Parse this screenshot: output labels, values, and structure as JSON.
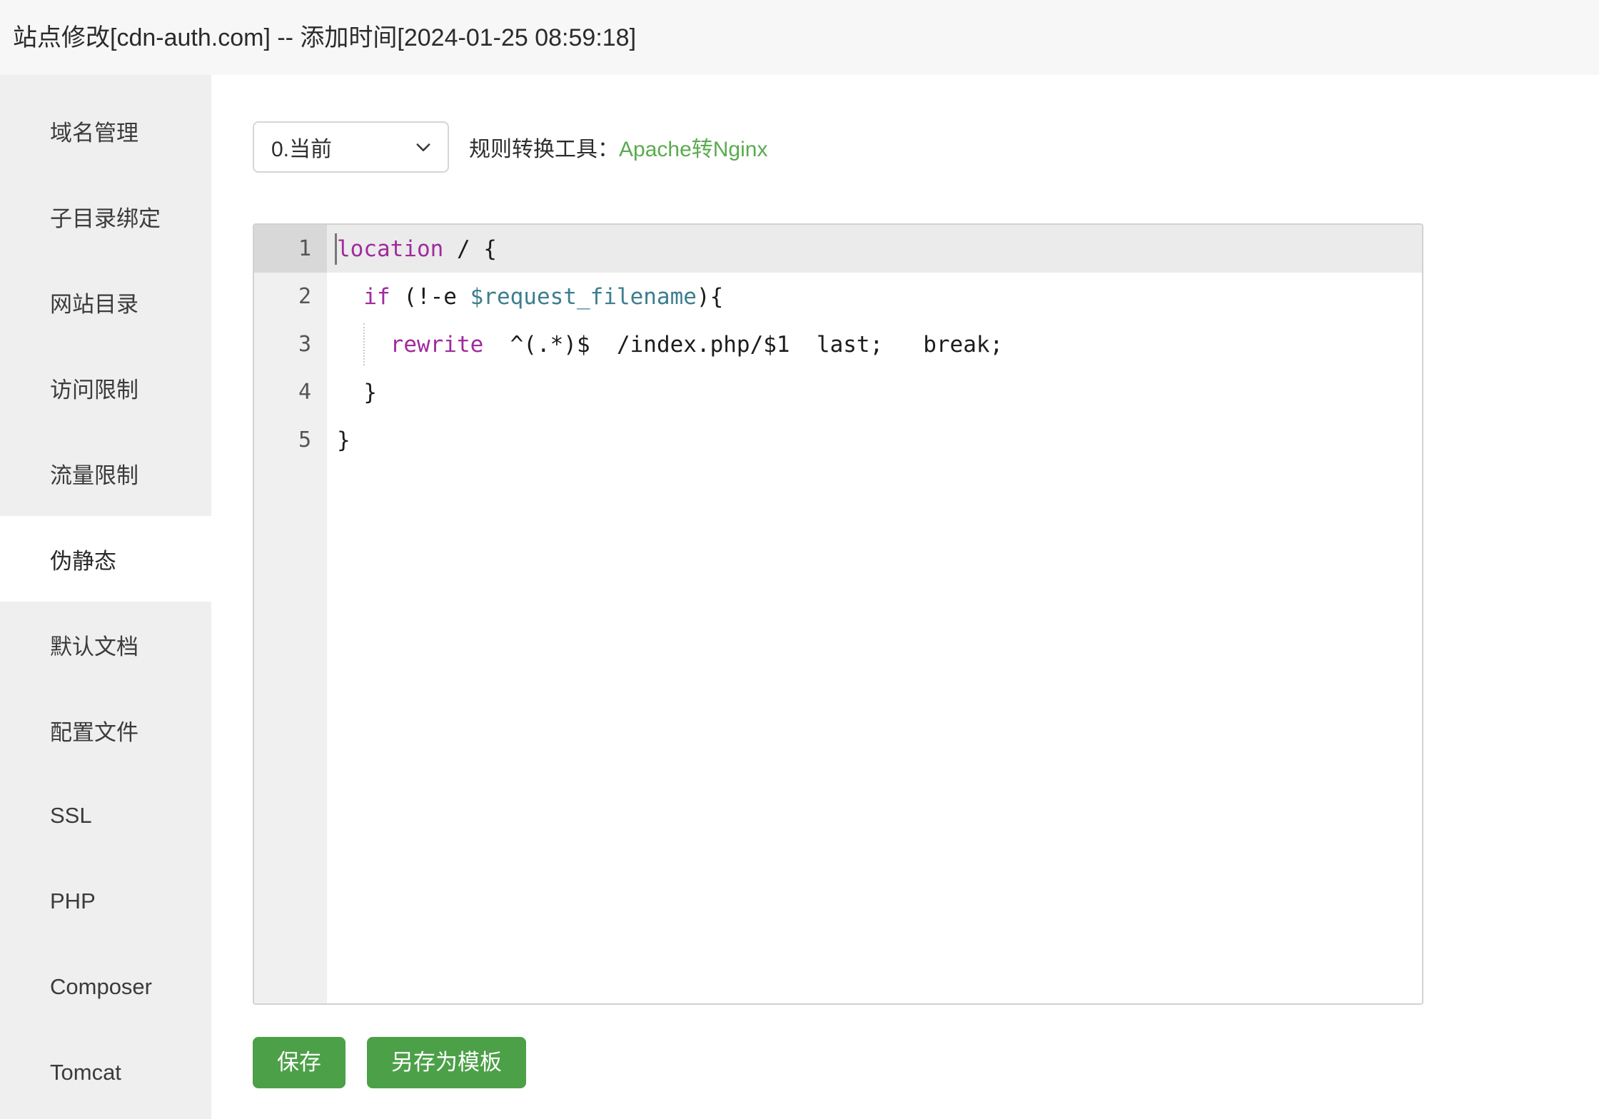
{
  "window": {
    "title": "站点修改[cdn-auth.com] -- 添加时间[2024-01-25 08:59:18]",
    "site_domain": "cdn-auth.com",
    "added_time": "2024-01-25 08:59:18"
  },
  "sidebar": {
    "active_index": 5,
    "items": [
      {
        "label": "域名管理",
        "name": "domain-management"
      },
      {
        "label": "子目录绑定",
        "name": "subdirectory-binding"
      },
      {
        "label": "网站目录",
        "name": "website-directory"
      },
      {
        "label": "访问限制",
        "name": "access-restriction"
      },
      {
        "label": "流量限制",
        "name": "traffic-limit"
      },
      {
        "label": "伪静态",
        "name": "rewrite"
      },
      {
        "label": "默认文档",
        "name": "default-document"
      },
      {
        "label": "配置文件",
        "name": "config-file"
      },
      {
        "label": "SSL",
        "name": "ssl"
      },
      {
        "label": "PHP",
        "name": "php"
      },
      {
        "label": "Composer",
        "name": "composer"
      },
      {
        "label": "Tomcat",
        "name": "tomcat"
      }
    ]
  },
  "toolbar": {
    "select_value": "0.当前",
    "select_options": [
      "0.当前"
    ],
    "chevron_icon": "chevron-down-icon",
    "converter_label": "规则转换工具：",
    "converter_link": "Apache转Nginx",
    "link_color": "#5aab4f"
  },
  "editor": {
    "active_line": 1,
    "lines": [
      {
        "num": "1",
        "text": "location / {"
      },
      {
        "num": "2",
        "text": "  if (!-e $request_filename){"
      },
      {
        "num": "3",
        "text": "    rewrite  ^(.*)$  /index.php/$1  last;   break;"
      },
      {
        "num": "4",
        "text": "  }"
      },
      {
        "num": "5",
        "text": "}"
      }
    ],
    "tokens": {
      "line1": {
        "kw": "location",
        "rest": " / {"
      },
      "line2": {
        "indent": "  ",
        "kw": "if",
        "mid": " (!-e ",
        "var": "$request_filename",
        "rest": "){"
      },
      "line3": {
        "indent": "    ",
        "kw": "rewrite",
        "rest": "  ^(.*)$  /index.php/$1  last;   break;"
      },
      "line4": {
        "text": "  }"
      },
      "line5": {
        "text": "}"
      }
    },
    "colors": {
      "keyword": "#a02a9e",
      "variable": "#3d7e8e",
      "default": "#1c1c1c",
      "active_line_bg": "#ebebeb",
      "gutter_bg": "#f0f0f0"
    }
  },
  "footer": {
    "save_label": "保存",
    "save_as_template_label": "另存为模板",
    "button_color": "#4ca047"
  }
}
